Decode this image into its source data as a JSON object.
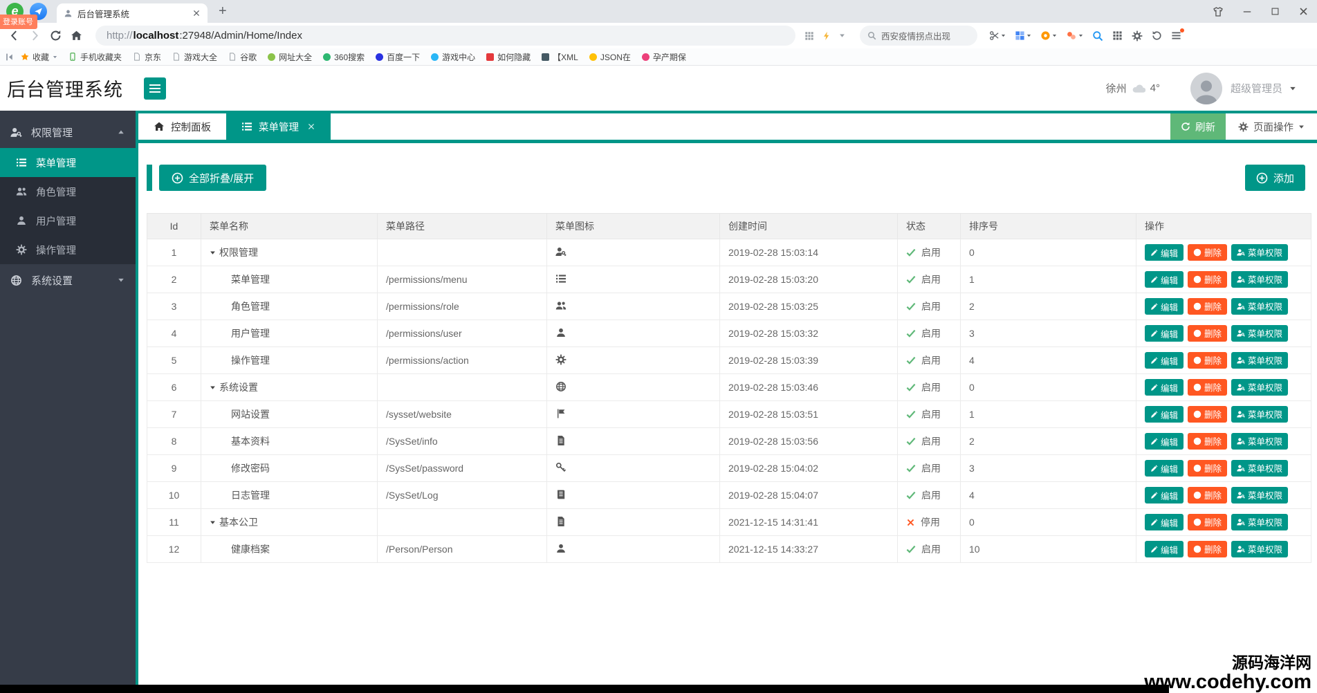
{
  "colors": {
    "teal": "#009688",
    "green": "#5FB878",
    "orange": "#FF5722",
    "sidebar_bg": "#363C48",
    "sidebar_sub_bg": "#282D37"
  },
  "browser": {
    "tab_title": "后台管理系统",
    "login_badge": "登录账号",
    "url_protocol": "http://",
    "url_host": "localhost",
    "url_rest": ":27948/Admin/Home/Index",
    "search_text": "西安疫情拐点出现",
    "bookmarks": [
      {
        "label": "收藏",
        "icon": "star",
        "color": "#FF9800",
        "caret": true
      },
      {
        "label": "手机收藏夹",
        "icon": "phone",
        "color": "#4CAF50"
      },
      {
        "label": "京东",
        "icon": "page",
        "color": "#9AA0A6"
      },
      {
        "label": "游戏大全",
        "icon": "page",
        "color": "#9AA0A6"
      },
      {
        "label": "谷歌",
        "icon": "page",
        "color": "#9AA0A6"
      },
      {
        "label": "网址大全",
        "icon": "dot",
        "color": "#8BC34A"
      },
      {
        "label": "360搜索",
        "icon": "dot",
        "color": "#2EB872"
      },
      {
        "label": "百度一下",
        "icon": "dot",
        "color": "#2932E1"
      },
      {
        "label": "游戏中心",
        "icon": "dot",
        "color": "#29B6F6"
      },
      {
        "label": "如何隐藏",
        "icon": "square",
        "color": "#E4393C"
      },
      {
        "label": "【XML",
        "icon": "square",
        "color": "#455A64"
      },
      {
        "label": "JSON在",
        "icon": "dot",
        "color": "#FFC107"
      },
      {
        "label": "孕产期保",
        "icon": "dot",
        "color": "#EC407A"
      }
    ]
  },
  "header": {
    "logo": "后台管理系统",
    "city": "徐州",
    "temperature": "4°",
    "role": "超级管理员"
  },
  "sidebar": {
    "sections": [
      {
        "label": "权限管理",
        "icon": "key-user",
        "state": "expanded",
        "items": [
          {
            "label": "菜单管理",
            "icon": "list",
            "active": true
          },
          {
            "label": "角色管理",
            "icon": "users",
            "active": false
          },
          {
            "label": "用户管理",
            "icon": "user",
            "active": false
          },
          {
            "label": "操作管理",
            "icon": "gear",
            "active": false
          }
        ]
      },
      {
        "label": "系统设置",
        "icon": "globe",
        "state": "collapsed",
        "items": []
      }
    ]
  },
  "tabs": {
    "items": [
      {
        "label": "控制面板",
        "icon": "home",
        "active": false,
        "closable": false
      },
      {
        "label": "菜单管理",
        "icon": "list",
        "active": true,
        "closable": true
      }
    ],
    "refresh_label": "刷新",
    "page_ops_label": "页面操作"
  },
  "toolbar": {
    "collapse_label": "全部折叠/展开",
    "add_label": "添加"
  },
  "table": {
    "columns": [
      "Id",
      "菜单名称",
      "菜单路径",
      "菜单图标",
      "创建时间",
      "状态",
      "排序号",
      "操作"
    ],
    "action_labels": {
      "edit": "编辑",
      "del": "删除",
      "perm": "菜单权限"
    },
    "status_labels": {
      "on": "启用",
      "off": "停用"
    },
    "rows": [
      {
        "id": 1,
        "name": "权限管理",
        "parent": true,
        "path": "",
        "icon": "key-user",
        "created": "2019-02-28 15:03:14",
        "enabled": true,
        "sort": 0
      },
      {
        "id": 2,
        "name": "菜单管理",
        "parent": false,
        "path": "/permissions/menu",
        "icon": "list",
        "created": "2019-02-28 15:03:20",
        "enabled": true,
        "sort": 1
      },
      {
        "id": 3,
        "name": "角色管理",
        "parent": false,
        "path": "/permissions/role",
        "icon": "users",
        "created": "2019-02-28 15:03:25",
        "enabled": true,
        "sort": 2
      },
      {
        "id": 4,
        "name": "用户管理",
        "parent": false,
        "path": "/permissions/user",
        "icon": "user",
        "created": "2019-02-28 15:03:32",
        "enabled": true,
        "sort": 3
      },
      {
        "id": 5,
        "name": "操作管理",
        "parent": false,
        "path": "/permissions/action",
        "icon": "gear",
        "created": "2019-02-28 15:03:39",
        "enabled": true,
        "sort": 4
      },
      {
        "id": 6,
        "name": "系统设置",
        "parent": true,
        "path": "",
        "icon": "globe",
        "created": "2019-02-28 15:03:46",
        "enabled": true,
        "sort": 0
      },
      {
        "id": 7,
        "name": "网站设置",
        "parent": false,
        "path": "/sysset/website",
        "icon": "flag",
        "created": "2019-02-28 15:03:51",
        "enabled": true,
        "sort": 1
      },
      {
        "id": 8,
        "name": "基本资料",
        "parent": false,
        "path": "/SysSet/info",
        "icon": "file",
        "created": "2019-02-28 15:03:56",
        "enabled": true,
        "sort": 2
      },
      {
        "id": 9,
        "name": "修改密码",
        "parent": false,
        "path": "/SysSet/password",
        "icon": "key",
        "created": "2019-02-28 15:04:02",
        "enabled": true,
        "sort": 3
      },
      {
        "id": 10,
        "name": "日志管理",
        "parent": false,
        "path": "/SysSet/Log",
        "icon": "book",
        "created": "2019-02-28 15:04:07",
        "enabled": true,
        "sort": 4
      },
      {
        "id": 11,
        "name": "基本公卫",
        "parent": true,
        "path": "",
        "icon": "file",
        "created": "2021-12-15 14:31:41",
        "enabled": false,
        "sort": 0
      },
      {
        "id": 12,
        "name": "健康档案",
        "parent": false,
        "path": "/Person/Person",
        "icon": "user",
        "created": "2021-12-15 14:33:27",
        "enabled": true,
        "sort": 10
      }
    ]
  },
  "watermark": {
    "line1": "源码海洋网",
    "line2": "www.codehy.com"
  }
}
